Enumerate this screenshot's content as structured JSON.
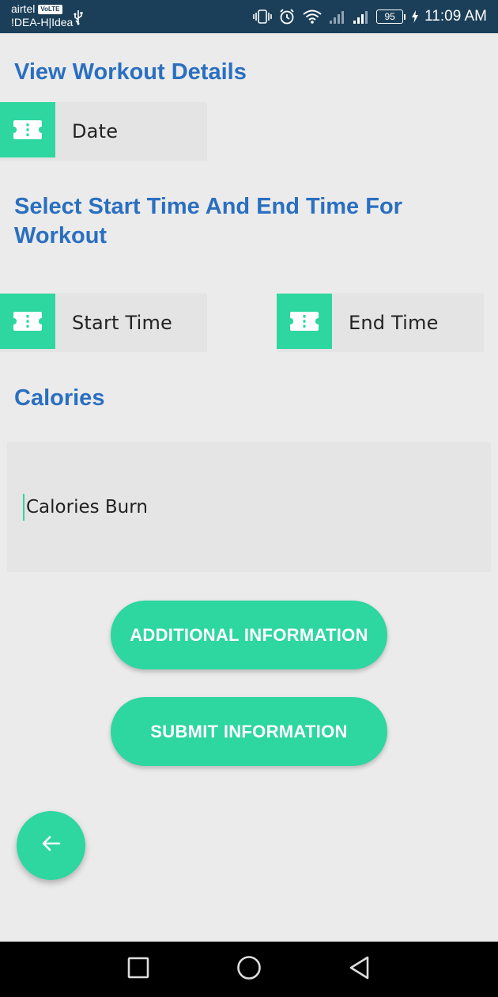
{
  "status_bar": {
    "carrier1": "airtel",
    "volte": "VoLTE",
    "carrier2": "!DEA-H|Idea",
    "battery": "95",
    "time": "11:09 AM",
    "icons": [
      "usb-icon",
      "vibrate-icon",
      "alarm-icon",
      "wifi-icon",
      "signal-icon",
      "signal-icon",
      "battery-icon",
      "charging-icon"
    ]
  },
  "page": {
    "title": "View Workout Details",
    "date_label": "Date",
    "time_section_title": "Select Start Time And End Time For Workout",
    "start_time_label": "Start Time",
    "end_time_label": "End Time",
    "calories_title": "Calories",
    "calories_placeholder": "Calories Burn",
    "additional_button": "ADDITIONAL INFORMATION",
    "submit_button": "SUBMIT INFORMATION"
  },
  "colors": {
    "accent": "#2ed6a0",
    "heading": "#2a6fc0",
    "status_bar": "#1b3f59",
    "background": "#ebebeb"
  },
  "fab": {
    "icon": "arrow-left-icon"
  },
  "nav_bar": {
    "icons": [
      "recents-icon",
      "home-icon",
      "back-icon"
    ]
  }
}
